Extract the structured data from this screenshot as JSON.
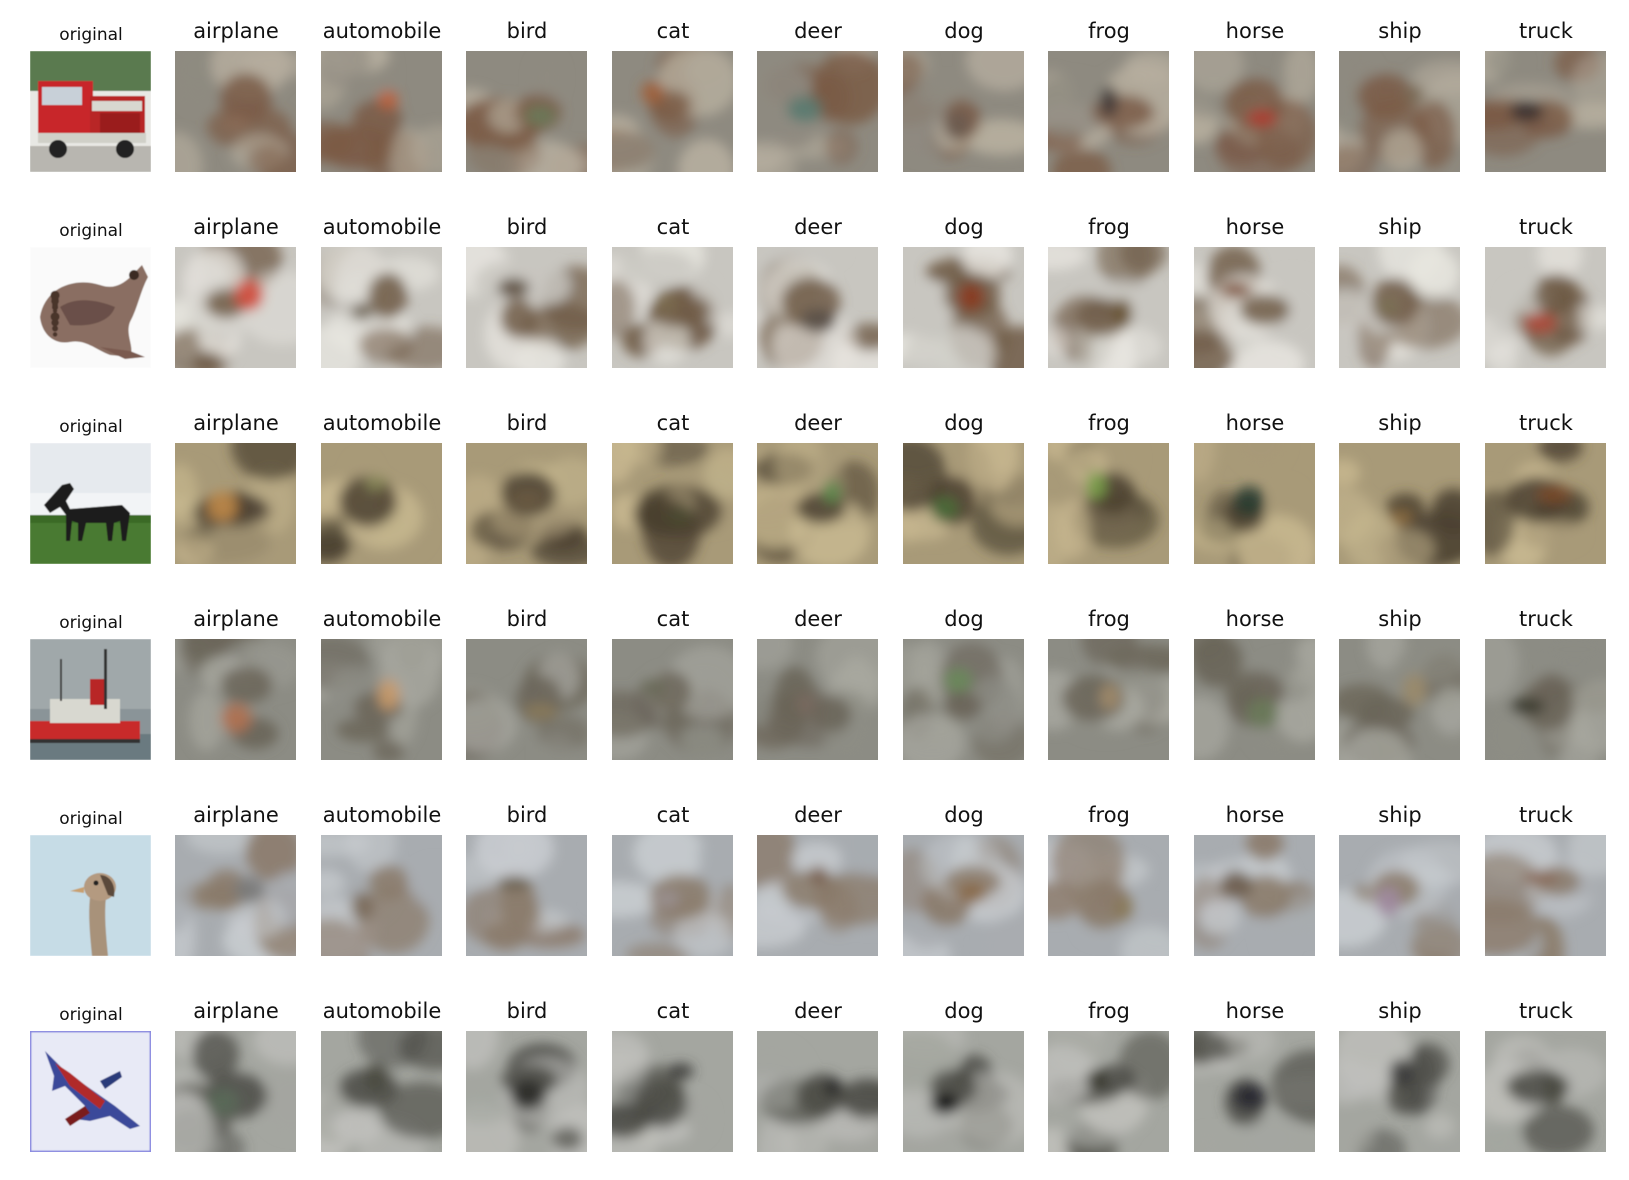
{
  "figure": {
    "column_labels": [
      "airplane",
      "automobile",
      "bird",
      "cat",
      "deer",
      "dog",
      "frog",
      "horse",
      "ship",
      "truck"
    ],
    "rows": [
      {
        "original_label": "original",
        "original_subject": "fire-truck",
        "palette": {
          "bg": "#8e8a80",
          "fg": "#7a5a45",
          "hi": "#b8b0a0",
          "accent": "#b04a35"
        },
        "reconstruction_accents": [
          "#8a6a55",
          "#c0603a",
          "#6a7a5a",
          "#a0603a",
          "#5a7a70",
          "#6a5a50",
          "#403a38",
          "#b03a30",
          "#7a6a55",
          "#3a3030"
        ]
      },
      {
        "original_label": "original",
        "original_subject": "frog",
        "palette": {
          "bg": "#c8c6c0",
          "fg": "#6e5a45",
          "hi": "#e8e6e0",
          "accent": "#c0503a"
        },
        "reconstruction_accents": [
          "#d04a3a",
          "#6a6050",
          "#5a4a3a",
          "#7a6a50",
          "#5a5048",
          "#8a3a20",
          "#6a5535",
          "#7a4a30",
          "#7a7055",
          "#b04a3a"
        ]
      },
      {
        "original_label": "original",
        "original_subject": "horse",
        "palette": {
          "bg": "#a89a78",
          "fg": "#4a4030",
          "hi": "#c8b890",
          "accent": "#5a7a3a"
        },
        "reconstruction_accents": [
          "#c08a4a",
          "#8a8a5a",
          "#6a5a40",
          "#4a4a30",
          "#5a8a4a",
          "#4a6a3a",
          "#7aa04a",
          "#2a3a30",
          "#8a6a40",
          "#7a4a2a"
        ]
      },
      {
        "original_label": "original",
        "original_subject": "ship",
        "palette": {
          "bg": "#8c8c84",
          "fg": "#6a6458",
          "hi": "#a8a8a0",
          "accent": "#c0403a"
        },
        "reconstruction_accents": [
          "#b07050",
          "#c89a6a",
          "#8a7a5a",
          "#6a6a5a",
          "#7a6a60",
          "#6a8a5a",
          "#a08a6a",
          "#6a7a5a",
          "#9a8a6a",
          "#3a3a30"
        ]
      },
      {
        "original_label": "original",
        "original_subject": "ostrich-head",
        "palette": {
          "bg": "#a8acb0",
          "fg": "#8a7a6a",
          "hi": "#c8ccd0",
          "accent": "#7a8aa0"
        },
        "reconstruction_accents": [
          "#7a7a7a",
          "#7a6a5a",
          "#6a6050",
          "#9a9090",
          "#7a6050",
          "#8a6a4a",
          "#8a7a5a",
          "#6a5a4a",
          "#a08aa0",
          "#8a6a5a"
        ]
      },
      {
        "original_label": "original",
        "original_subject": "jet-fighter",
        "palette": {
          "bg": "#a4a6a0",
          "fg": "#4a4a44",
          "hi": "#c0c0bc",
          "accent": "#3a4a8a"
        },
        "reconstruction_accents": [
          "#5a6a5a",
          "#4a4a40",
          "#2a2a28",
          "#3a3a38",
          "#2a2a2a",
          "#101010",
          "#3a3a30",
          "#2a2a30",
          "#3a3a38",
          "#4a4a40"
        ]
      }
    ]
  }
}
